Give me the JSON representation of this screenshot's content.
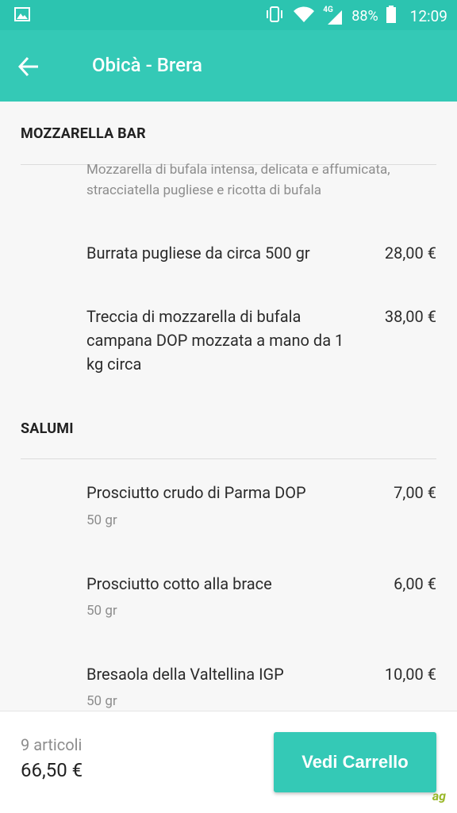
{
  "status_bar": {
    "network": "4G",
    "battery": "88%",
    "time": "12:09"
  },
  "toolbar": {
    "title": "Obicà - Brera"
  },
  "sections": [
    {
      "title": "MOZZARELLA BAR",
      "description": "Mozzarella di bufala intensa, delicata e affumicata, stracciatella pugliese e ricotta di bufala",
      "items": [
        {
          "name": "Burrata pugliese da circa 500 gr",
          "price": "28,00 €"
        },
        {
          "name": "Treccia di mozzarella di bufala campana DOP mozzata a mano da 1 kg circa",
          "price": "38,00 €"
        }
      ]
    },
    {
      "title": "SALUMI",
      "items": [
        {
          "name": "Prosciutto crudo di Parma DOP",
          "price": "7,00 €",
          "qty": "50 gr"
        },
        {
          "name": "Prosciutto cotto alla brace",
          "price": "6,00 €",
          "qty": "50 gr"
        },
        {
          "name": "Bresaola della Valtellina IGP",
          "price": "10,00 €",
          "qty": "50 gr"
        }
      ]
    }
  ],
  "cart": {
    "count": "9 articoli",
    "total": "66,50 €",
    "button_label": "Vedi Carrello"
  },
  "colors": {
    "accent": "#34c9b6",
    "status_bar": "#2cc4b0"
  }
}
